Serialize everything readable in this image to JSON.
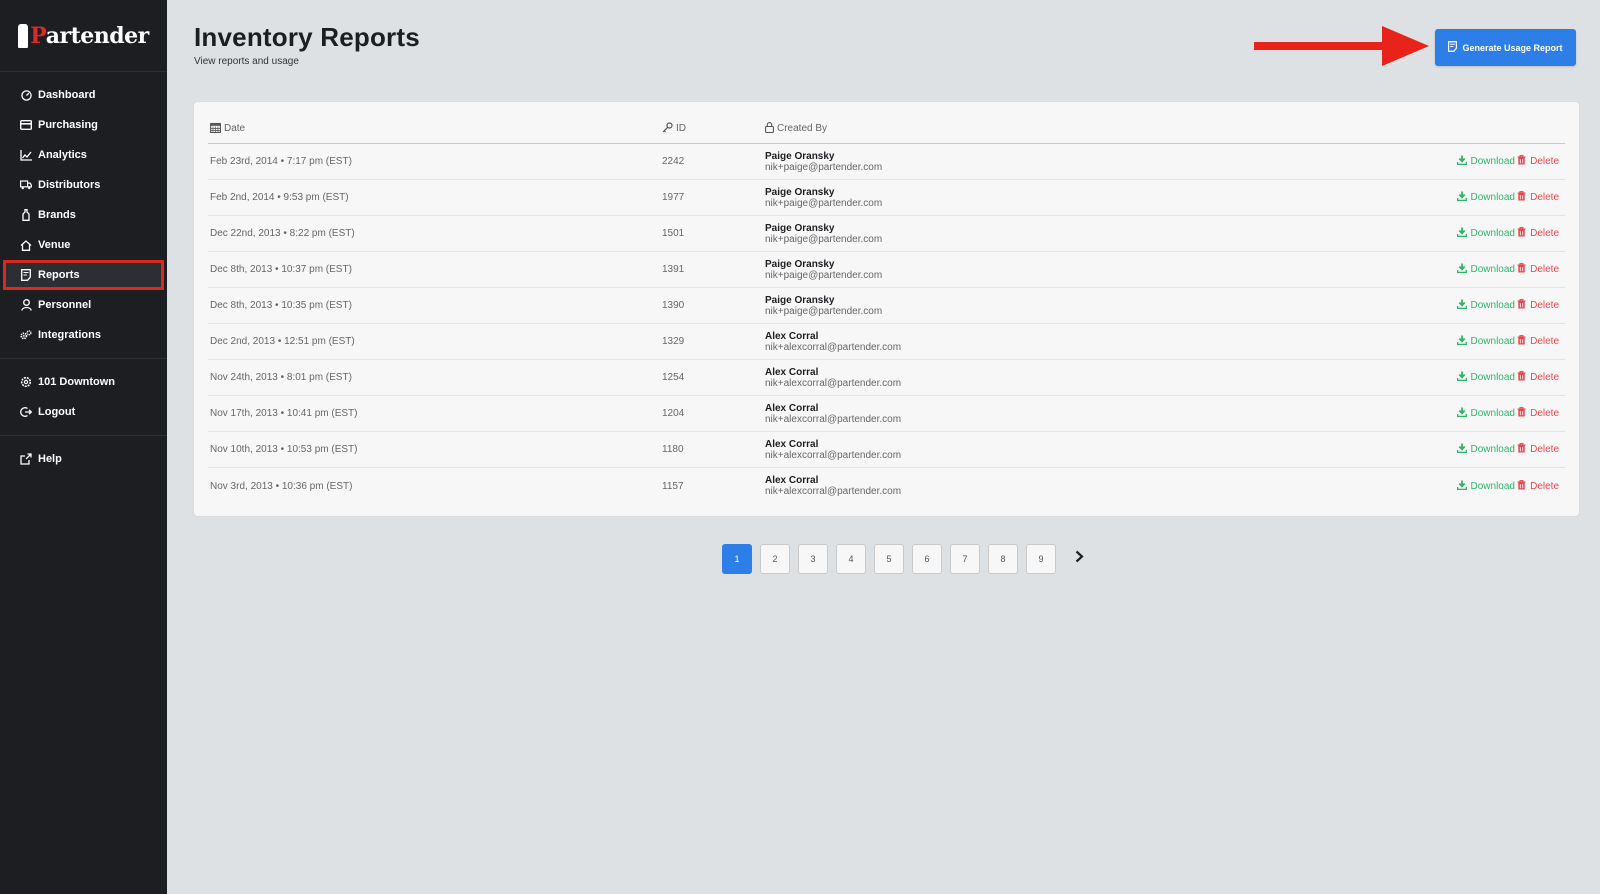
{
  "brand": {
    "logo_prefix": "P",
    "logo_rest": "artender"
  },
  "sidebar": {
    "items": [
      {
        "label": "Dashboard",
        "icon": "dashboard-icon"
      },
      {
        "label": "Purchasing",
        "icon": "credit-card-icon"
      },
      {
        "label": "Analytics",
        "icon": "chart-line-icon"
      },
      {
        "label": "Distributors",
        "icon": "truck-icon"
      },
      {
        "label": "Brands",
        "icon": "bottle-icon"
      },
      {
        "label": "Venue",
        "icon": "home-icon"
      },
      {
        "label": "Reports",
        "icon": "report-icon",
        "active": true
      },
      {
        "label": "Personnel",
        "icon": "user-icon"
      },
      {
        "label": "Integrations",
        "icon": "cogs-icon"
      }
    ],
    "secondary": [
      {
        "label": "101 Downtown",
        "icon": "settings-icon"
      },
      {
        "label": "Logout",
        "icon": "logout-icon"
      }
    ],
    "help": {
      "label": "Help",
      "icon": "external-link-icon"
    }
  },
  "header": {
    "title": "Inventory Reports",
    "subtitle": "View reports and usage",
    "generate_button": "Generate Usage Report"
  },
  "table": {
    "columns": {
      "date": "Date",
      "id": "ID",
      "created_by": "Created By"
    },
    "download_label": "Download",
    "delete_label": "Delete",
    "rows": [
      {
        "date": "Feb 23rd, 2014 • 7:17 pm (EST)",
        "id": "2242",
        "name": "Paige Oransky",
        "email": "nik+paige@partender.com"
      },
      {
        "date": "Feb 2nd, 2014 • 9:53 pm (EST)",
        "id": "1977",
        "name": "Paige Oransky",
        "email": "nik+paige@partender.com"
      },
      {
        "date": "Dec 22nd, 2013 • 8:22 pm (EST)",
        "id": "1501",
        "name": "Paige Oransky",
        "email": "nik+paige@partender.com"
      },
      {
        "date": "Dec 8th, 2013 • 10:37 pm (EST)",
        "id": "1391",
        "name": "Paige Oransky",
        "email": "nik+paige@partender.com"
      },
      {
        "date": "Dec 8th, 2013 • 10:35 pm (EST)",
        "id": "1390",
        "name": "Paige Oransky",
        "email": "nik+paige@partender.com"
      },
      {
        "date": "Dec 2nd, 2013 • 12:51 pm (EST)",
        "id": "1329",
        "name": "Alex Corral",
        "email": "nik+alexcorral@partender.com"
      },
      {
        "date": "Nov 24th, 2013 • 8:01 pm (EST)",
        "id": "1254",
        "name": "Alex Corral",
        "email": "nik+alexcorral@partender.com"
      },
      {
        "date": "Nov 17th, 2013 • 10:41 pm (EST)",
        "id": "1204",
        "name": "Alex Corral",
        "email": "nik+alexcorral@partender.com"
      },
      {
        "date": "Nov 10th, 2013 • 10:53 pm (EST)",
        "id": "1180",
        "name": "Alex Corral",
        "email": "nik+alexcorral@partender.com"
      },
      {
        "date": "Nov 3rd, 2013 • 10:36 pm (EST)",
        "id": "1157",
        "name": "Alex Corral",
        "email": "nik+alexcorral@partender.com"
      }
    ]
  },
  "pagination": {
    "pages": [
      "1",
      "2",
      "3",
      "4",
      "5",
      "6",
      "7",
      "8",
      "9"
    ],
    "current": "1"
  },
  "colors": {
    "accent": "#2e7ee8",
    "download": "#2fb56a",
    "delete": "#e8474f",
    "sidebar": "#1d1e22",
    "highlight": "#d72a1f"
  }
}
